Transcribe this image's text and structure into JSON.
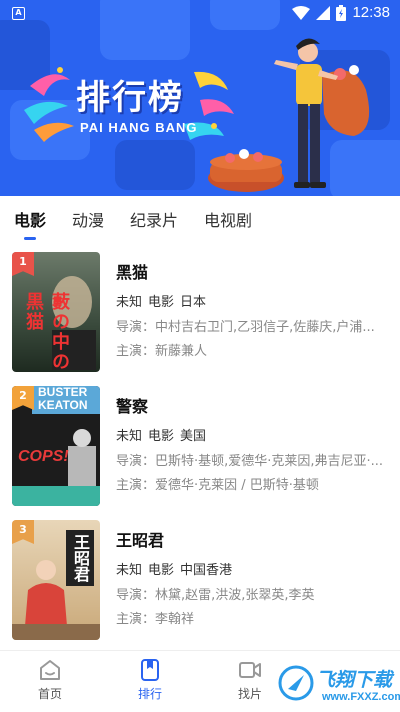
{
  "status_bar": {
    "time": "12:38",
    "app_icon_letter": "A"
  },
  "banner": {
    "title": "排行榜",
    "subtitle": "PAI HANG BANG"
  },
  "tabs": [
    {
      "label": "电影",
      "active": true
    },
    {
      "label": "动漫",
      "active": false
    },
    {
      "label": "纪录片",
      "active": false
    },
    {
      "label": "电视剧",
      "active": false
    }
  ],
  "items": [
    {
      "rank": "1",
      "title": "黑猫",
      "year": "未知",
      "type": "电影",
      "region": "日本",
      "director": "导演：中村吉右卫门,乙羽信子,佐藤庆,户浦...",
      "cast": "主演：新藤兼人",
      "badge_color": "#e8534a",
      "poster_text": "藪の中の黒猫"
    },
    {
      "rank": "2",
      "title": "警察",
      "year": "未知",
      "type": "电影",
      "region": "美国",
      "director": "导演：巴斯特·基顿,爱德华·克莱因,弗吉尼亚·...",
      "cast": "主演：爱德华·克莱因 / 巴斯特·基顿",
      "badge_color": "#f2a23a",
      "poster_text_1": "BUSTER",
      "poster_text_2": "KEATON",
      "poster_text_3": "COPS!"
    },
    {
      "rank": "3",
      "title": "王昭君",
      "year": "未知",
      "type": "电影",
      "region": "中国香港",
      "director": "导演：林黛,赵雷,洪波,张翠英,李英",
      "cast": "主演：李翰祥",
      "badge_color": "#e8a04a",
      "poster_text": "王昭君"
    }
  ],
  "bottom_nav": [
    {
      "label": "首页",
      "icon": "home-icon",
      "active": false
    },
    {
      "label": "排行",
      "icon": "ranking-icon",
      "active": true
    },
    {
      "label": "找片",
      "icon": "video-icon",
      "active": false
    }
  ],
  "watermark": {
    "text": "飞翔下载",
    "sub": "www.FXXZ.com"
  },
  "colors": {
    "accent": "#2a63f0",
    "banner_bg": "#2a63f0"
  }
}
